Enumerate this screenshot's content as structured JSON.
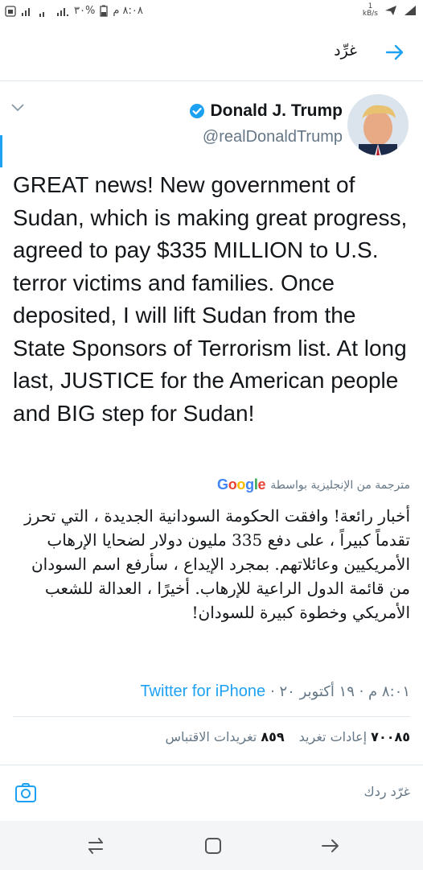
{
  "status_bar": {
    "time": "٨:٠٨ م",
    "battery": "%٣٠",
    "network_speed": "1\nkB/s"
  },
  "header": {
    "title": "غرِّد"
  },
  "tweet": {
    "author_name": "Donald J. Trump",
    "author_handle": "@realDonaldTrump",
    "text": "GREAT news! New government of Sudan, which is making great progress, agreed to pay $335 MILLION to U.S. terror victims and families. Once deposited, I will lift Sudan from the State Sponsors of Terrorism list. At long last, JUSTICE for the American people and BIG step for Sudan!",
    "translation_label": "مترجمة من الإنجليزية بواسطة",
    "translation_provider": "Google",
    "translated_text": "أخبار رائعة! وافقت الحكومة السودانية الجديدة ، التي تحرز تقدماً كبيراً ، على دفع 335 مليون دولار لضحايا الإرهاب الأمريكيين وعائلاتهم. بمجرد الإيداع ، سأرفع اسم السودان من قائمة الدول الراعية للإرهاب. أخيرًا ، العدالة للشعب الأمريكي وخطوة كبيرة للسودان!",
    "timestamp": "٨:٠١ م · ١٩ أكتوبر ٢٠ ·",
    "source": "Twitter for iPhone",
    "retweets_count": "٧٠٠٨٥",
    "retweets_label": "إعادات تغريد",
    "quotes_count": "٨٥٩",
    "quotes_label": "تغريدات الاقتباس"
  },
  "reply": {
    "placeholder": "غرّد ردك"
  },
  "colors": {
    "accent": "#1da1f2",
    "text": "#14171a",
    "muted": "#657786"
  }
}
